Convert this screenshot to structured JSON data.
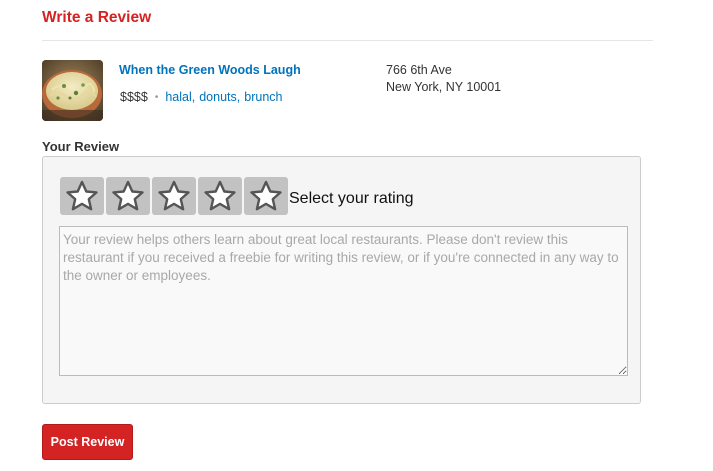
{
  "page": {
    "title": "Write a Review"
  },
  "business": {
    "name": "When the Green Woods Laugh",
    "price": "$$$$",
    "categories": [
      "halal",
      "donuts",
      "brunch"
    ],
    "address_line1": "766 6th Ave",
    "address_line2": "New York, NY 10001",
    "photo_icon": "food-photo-icon"
  },
  "review": {
    "label": "Your Review",
    "rating_prompt": "Select your rating",
    "rating_value": 0,
    "rating_max": 5,
    "placeholder": "Your review helps others learn about great local restaurants. Please don't review this restaurant if you received a freebie for writing this review, or if you're connected in any way to the owner or employees."
  },
  "actions": {
    "post_label": "Post Review"
  },
  "colors": {
    "accent": "#d32323",
    "link": "#0073bb",
    "star_bg": "#c2c2c2"
  }
}
